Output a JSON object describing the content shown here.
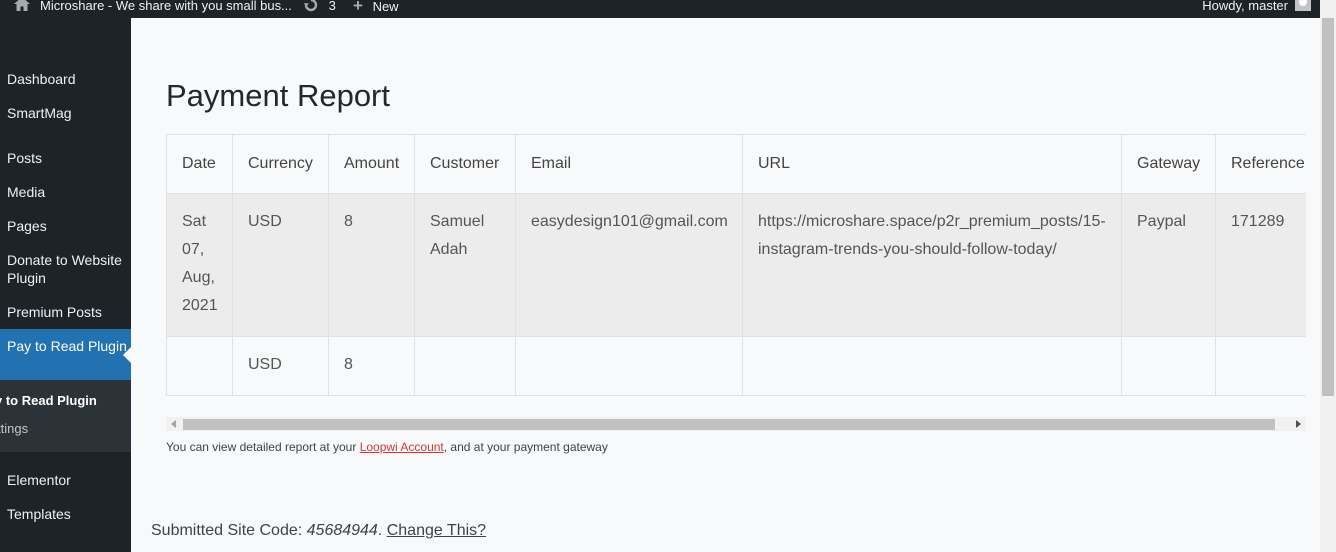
{
  "adminbar": {
    "site_name": "Microshare - We share with you small bus...",
    "updates_count": "3",
    "new_label": "New",
    "howdy": "Howdy, master"
  },
  "sidebar": {
    "items": [
      {
        "label": "Dashboard"
      },
      {
        "label": "SmartMag"
      },
      {
        "label": "Posts"
      },
      {
        "label": "Media"
      },
      {
        "label": "Pages"
      },
      {
        "label": "Donate to Website Plugin"
      },
      {
        "label": "Premium Posts"
      },
      {
        "label": "Pay to Read Plugin"
      },
      {
        "label": "Elementor"
      },
      {
        "label": "Templates"
      }
    ],
    "submenu": [
      {
        "label": "y to Read Plugin"
      },
      {
        "label": "ttings"
      }
    ]
  },
  "main": {
    "title": "Payment Report",
    "table": {
      "headers": [
        "Date",
        "Currency",
        "Amount",
        "Customer",
        "Email",
        "URL",
        "Gateway",
        "Reference"
      ],
      "rows": [
        [
          "Sat 07, Aug, 2021",
          "USD",
          "8",
          "Samuel Adah",
          "easydesign101@gmail.com",
          "https://microshare.space/p2r_premium_posts/15-instagram-trends-you-should-follow-today/",
          "Paypal",
          "171289"
        ],
        [
          "",
          "USD",
          "8",
          "",
          "",
          "",
          "",
          ""
        ]
      ]
    },
    "note": {
      "prefix": "You can view detailed report at your ",
      "link": "Loopwi Account",
      "suffix": ", and at your payment gateway"
    },
    "sitecode": {
      "label": "Submitted Site Code: ",
      "code": "45684944",
      "sep": ". ",
      "change_link": "Change This?"
    }
  },
  "colors": {
    "adminbar_bg": "#1d2327",
    "sidebar_bg": "#1d2327",
    "active_menu": "#2271b1",
    "link_red": "#d63638"
  }
}
